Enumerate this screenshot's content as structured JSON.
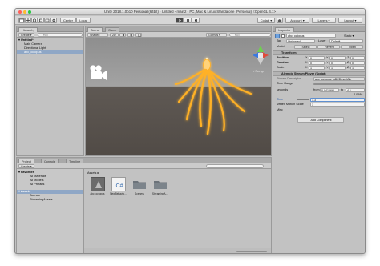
{
  "window": {
    "title": "Unity 2018.1.0b10 Personal (64bit) - Untitled - main2 - PC, Mac & Linux Standalone (Personal) <OpenGL 4.1>"
  },
  "toolbar": {
    "pivot": "Center",
    "space": "Local",
    "collab": "Collab ▾",
    "account": "Account ▾",
    "layers": "Layers ▾",
    "layout": "Layout ▾"
  },
  "hierarchy": {
    "tab": "Hierarchy",
    "create": "Create ▾",
    "search_placeholder": "▾All",
    "items": [
      {
        "label": "▾ Untitled*"
      },
      {
        "label": "Main Camera"
      },
      {
        "label": "Directional Light"
      },
      {
        "label": "abc_octopus"
      }
    ]
  },
  "scene": {
    "tabs": [
      "Scene",
      "Game"
    ],
    "shading": "Shaded",
    "mode": "2D",
    "gizmos": "Gizmos ▾",
    "search_placeholder": "▾All",
    "persp": "< Persp"
  },
  "inspector": {
    "tab": "Inspector",
    "object_name": "abc_octopus",
    "static": "Static ▾",
    "tag_label": "Tag",
    "tag_value": "Untagged",
    "layer_label": "Layer",
    "layer_value": "Default",
    "model_label": "Model",
    "model_buttons": [
      "Select",
      "Revert",
      "Open"
    ],
    "transform": {
      "title": "Transform",
      "rows": [
        {
          "label": "Position",
          "x": "0",
          "y": "0",
          "z": "0"
        },
        {
          "label": "Rotation",
          "x": "0",
          "y": "0",
          "z": "0"
        },
        {
          "label": "Scale",
          "x": "1",
          "y": "1",
          "z": "1"
        }
      ],
      "axis_labels": [
        "X",
        "Y",
        "Z"
      ]
    },
    "stream_player": {
      "title": "Alembic Stream Player (Script)",
      "descriptor_label": "Stream Descriptor",
      "descriptor_value": "abc_octopus_ABCDesc (Ale",
      "time_range_label": "Time Range",
      "seconds_label": "seconds",
      "from_label": "from",
      "from_value": "0.041666",
      "to_label": "to",
      "to_value": "4.1",
      "duration": "4.058s",
      "time_label": "Time",
      "time_value": "1.3",
      "vertex_label": "Vertex Motion Scale",
      "vertex_value": "1"
    },
    "misc_label": "Misc",
    "add_component": "Add Component"
  },
  "project": {
    "tabs": [
      "Project",
      "Console",
      "Timeline"
    ],
    "create": "Create ▾",
    "favorites_label": "▾ Favorites",
    "favorites": [
      "All Materials",
      "All Models",
      "All Prefabs"
    ],
    "assets_label": "▾ Assets",
    "asset_folders": [
      "Scenes",
      "StreamingAssets"
    ],
    "breadcrumb": "Assets ▸",
    "assets": [
      {
        "name": "abc_octopus",
        "kind": "model"
      },
      {
        "name": "NewBehavio...",
        "kind": "script"
      },
      {
        "name": "Scenes",
        "kind": "folder"
      },
      {
        "name": "StreamingA...",
        "kind": "folder"
      }
    ]
  },
  "colors": {
    "accent_selection": "#8fa7c6",
    "octopus_glow": "#ffb126",
    "ground": "#524c47",
    "sky": "#999999"
  }
}
